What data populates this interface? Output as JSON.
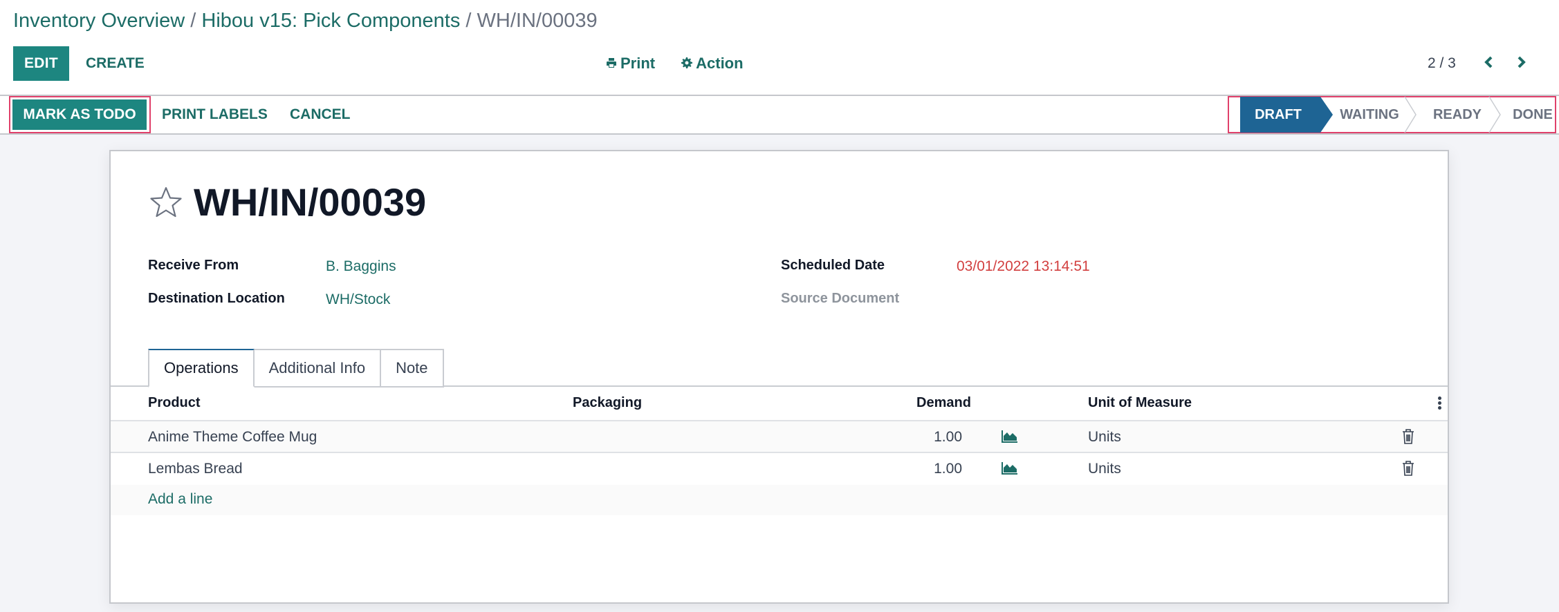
{
  "breadcrumb": {
    "items": [
      "Inventory Overview",
      "Hibou v15: Pick Components"
    ],
    "separator": " / ",
    "current": "WH/IN/00039"
  },
  "toolbar": {
    "edit_label": "EDIT",
    "create_label": "CREATE",
    "print_label": "Print",
    "print_icon": "printer-icon",
    "action_label": "Action",
    "action_icon": "gear-icon"
  },
  "pager": {
    "value": "2 / 3",
    "prev_icon": "chevron-left-icon",
    "next_icon": "chevron-right-icon"
  },
  "statusbar": {
    "buttons": [
      "MARK AS TODO",
      "PRINT LABELS",
      "CANCEL"
    ],
    "stages": [
      "DRAFT",
      "WAITING",
      "READY",
      "DONE"
    ],
    "active_stage": "DRAFT",
    "highlight_color": "#e0406a"
  },
  "record": {
    "title": "WH/IN/00039",
    "favorite_icon": "star-icon",
    "fields": {
      "receive_from": {
        "label": "Receive From",
        "value": "B. Baggins"
      },
      "destination_location": {
        "label": "Destination Location",
        "value": "WH/Stock"
      },
      "scheduled_date": {
        "label": "Scheduled Date",
        "value": "03/01/2022 13:14:51"
      },
      "source_document": {
        "label": "Source Document",
        "value": ""
      }
    }
  },
  "tabs": [
    {
      "label": "Operations",
      "active": true
    },
    {
      "label": "Additional Info",
      "active": false
    },
    {
      "label": "Note",
      "active": false
    }
  ],
  "operations": {
    "columns": [
      "Product",
      "Packaging",
      "Demand",
      "Unit of Measure"
    ],
    "rows": [
      {
        "product": "Anime Theme Coffee Mug",
        "packaging": "",
        "demand": "1.00",
        "uom": "Units"
      },
      {
        "product": "Lembas Bread",
        "packaging": "",
        "demand": "1.00",
        "uom": "Units"
      }
    ],
    "add_line_label": "Add a line"
  },
  "colors": {
    "brand": "#1d8680",
    "link": "#1c6c66",
    "stage_active": "#1e6494",
    "late_date": "#d23f3f"
  }
}
